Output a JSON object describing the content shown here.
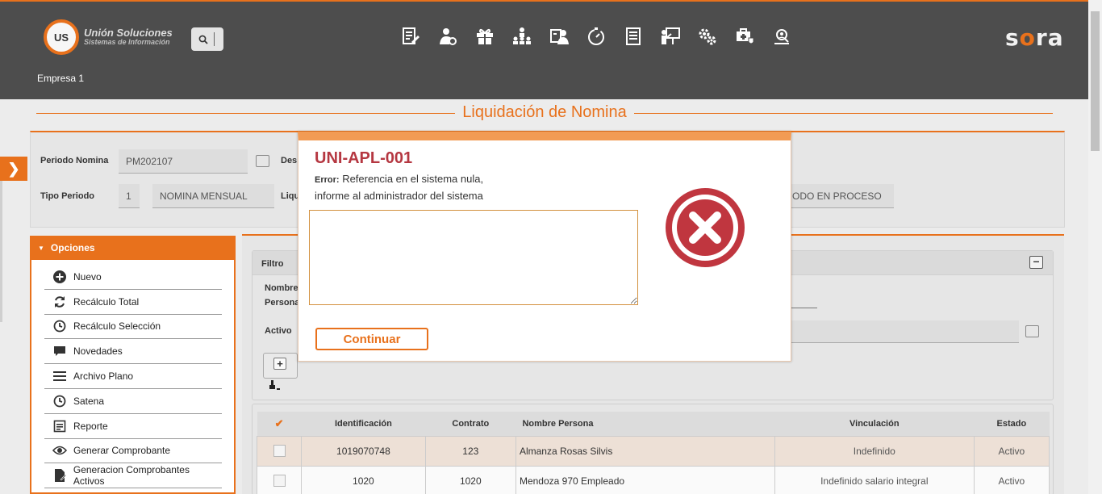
{
  "header": {
    "logo_mark": "US",
    "logo_title": "Unión Soluciones",
    "logo_subtitle": "Sistemas de Información",
    "brand_prefix": "s",
    "brand_accent": "o",
    "brand_suffix": "ra",
    "empresa": "Empresa 1",
    "modules": [
      "edit-document-icon",
      "person-settings-icon",
      "gift-icon",
      "org-chart-icon",
      "employee-card-icon",
      "timer-icon",
      "list-document-icon",
      "presentation-icon",
      "gears-icon",
      "medical-kit-icon",
      "people-search-icon"
    ]
  },
  "page": {
    "title": "Liquidación de Nomina"
  },
  "period": {
    "periodo_label": "Periodo Nomina",
    "periodo_value": "PM202107",
    "desc_label": "Des",
    "tipo_label": "Tipo Periodo",
    "tipo_code": "1",
    "tipo_name": "NOMINA MENSUAL",
    "liq_label": "Liqu",
    "estado_value": "ODO EN PROCESO"
  },
  "options": {
    "title": "Opciones",
    "items": [
      {
        "label": "Nuevo",
        "icon": "plus-circle-icon"
      },
      {
        "label": "Recálculo Total",
        "icon": "refresh-icon"
      },
      {
        "label": "Recálculo Selección",
        "icon": "clock-icon"
      },
      {
        "label": "Novedades",
        "icon": "speech-bubble-icon"
      },
      {
        "label": "Archivo Plano",
        "icon": "menu-lines-icon"
      },
      {
        "label": "Satena",
        "icon": "clock-icon"
      },
      {
        "label": "Reporte",
        "icon": "report-icon"
      },
      {
        "label": "Generar Comprobante",
        "icon": "eye-icon"
      },
      {
        "label": "Generacion Comprobantes Activos",
        "icon": "file-pen-icon"
      }
    ]
  },
  "filter": {
    "title": "Filtro",
    "nombre_label_1": "Nombre",
    "nombre_label_2": "Persona",
    "activo_label": "Activo"
  },
  "grid": {
    "columns": [
      "Identificación",
      "Contrato",
      "Nombre Persona",
      "Vinculación",
      "Estado"
    ],
    "rows": [
      {
        "id": "1019070748",
        "contrato": "123",
        "nombre": "Almanza Rosas Silvis",
        "vinculacion": "Indefinido",
        "estado": "Activo"
      },
      {
        "id": "1020",
        "contrato": "1020",
        "nombre": "Mendoza 970 Empleado",
        "vinculacion": "Indefinido salario integral",
        "estado": "Activo"
      }
    ]
  },
  "modal": {
    "code": "UNI-APL-001",
    "error_label": "Error:",
    "line1": "Referencia en el sistema nula,",
    "line2": "informe al administrador del sistema",
    "textarea_value": "",
    "button": "Continuar"
  },
  "colors": {
    "accent": "#e8711c",
    "header_bg": "#4d4d4d",
    "error": "#b53741"
  }
}
